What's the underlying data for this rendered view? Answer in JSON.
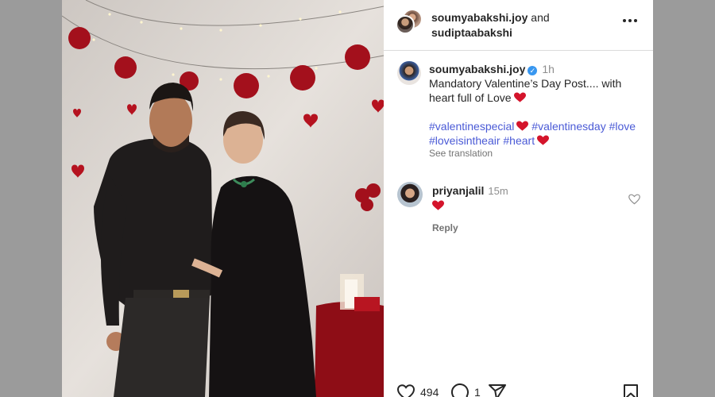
{
  "header": {
    "user1": "soumyabakshi.joy",
    "joiner": " and",
    "user2": "sudiptaabakshi"
  },
  "caption": {
    "username": "soumyabakshi.joy",
    "verified_glyph": "✓",
    "time": "1h",
    "text": "Mandatory Valentine’s Day Post.... with heart full of Love",
    "hashtags": [
      "#valentinespecial",
      "#valentinesday",
      "#love",
      "#loveisintheair",
      "#heart"
    ],
    "see_translation": "See translation"
  },
  "comment": {
    "username": "priyanjalil",
    "time": "15m",
    "reply": "Reply"
  },
  "actions": {
    "likes": "494",
    "comments": "1"
  },
  "icons": {
    "more": "more-icon",
    "like": "heart-outline-icon",
    "comment": "comment-icon",
    "share": "share-icon",
    "save": "bookmark-icon"
  },
  "colors": {
    "hashtag": "#4a5ad6",
    "heart_emoji": "#d4142b",
    "verified": "#3897f0"
  }
}
